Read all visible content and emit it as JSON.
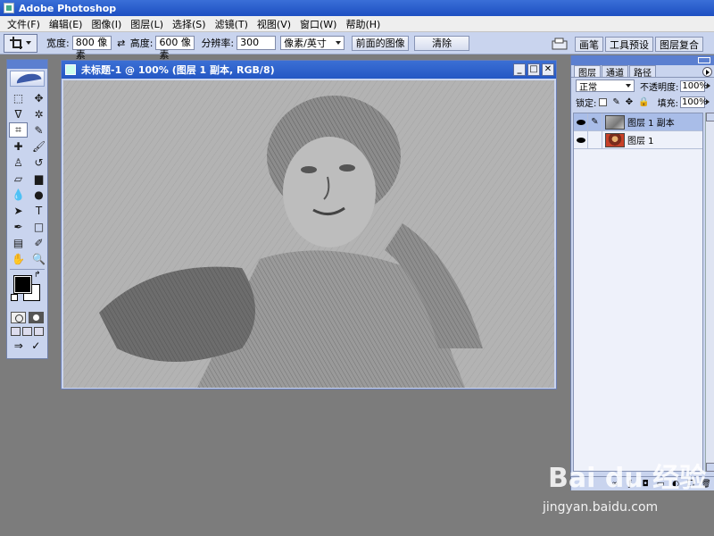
{
  "app": {
    "title": "Adobe Photoshop"
  },
  "menu": {
    "items": [
      "文件(F)",
      "编辑(E)",
      "图像(I)",
      "图层(L)",
      "选择(S)",
      "滤镜(T)",
      "视图(V)",
      "窗口(W)",
      "帮助(H)"
    ]
  },
  "options": {
    "width_label": "宽度:",
    "width_value": "800 像素",
    "height_label": "高度:",
    "height_value": "600 像素",
    "resolution_label": "分辨率:",
    "resolution_value": "300",
    "unit_value": "像素/英寸",
    "front_image_label": "前面的图像",
    "clear_label": "清除"
  },
  "palette_well": {
    "tabs": [
      "画笔",
      "工具预设",
      "图层复合"
    ]
  },
  "toolbox": {
    "tools": [
      {
        "name": "marquee-tool-icon",
        "glyph": "⬚"
      },
      {
        "name": "move-tool-icon",
        "glyph": "✥"
      },
      {
        "name": "lasso-tool-icon",
        "glyph": "ᐁ"
      },
      {
        "name": "magic-wand-tool-icon",
        "glyph": "✲"
      },
      {
        "name": "crop-tool-icon",
        "glyph": "⌗"
      },
      {
        "name": "slice-tool-icon",
        "glyph": "✎"
      },
      {
        "name": "healing-brush-tool-icon",
        "glyph": "✚"
      },
      {
        "name": "brush-tool-icon",
        "glyph": "🖌"
      },
      {
        "name": "clone-stamp-tool-icon",
        "glyph": "♙"
      },
      {
        "name": "history-brush-tool-icon",
        "glyph": "↺"
      },
      {
        "name": "eraser-tool-icon",
        "glyph": "▱"
      },
      {
        "name": "gradient-tool-icon",
        "glyph": "▆"
      },
      {
        "name": "blur-tool-icon",
        "glyph": "💧"
      },
      {
        "name": "dodge-tool-icon",
        "glyph": "●"
      },
      {
        "name": "path-selection-tool-icon",
        "glyph": "➤"
      },
      {
        "name": "type-tool-icon",
        "glyph": "T"
      },
      {
        "name": "pen-tool-icon",
        "glyph": "✒"
      },
      {
        "name": "shape-tool-icon",
        "glyph": "□"
      },
      {
        "name": "notes-tool-icon",
        "glyph": "▤"
      },
      {
        "name": "eyedropper-tool-icon",
        "glyph": "✐"
      },
      {
        "name": "hand-tool-icon",
        "glyph": "✋"
      },
      {
        "name": "zoom-tool-icon",
        "glyph": "🔍"
      }
    ]
  },
  "document": {
    "title": "未标题-1 @ 100% (图层 1 副本, RGB/8)"
  },
  "layers_panel": {
    "tabs": [
      "图层",
      "通道",
      "路径"
    ],
    "blend_mode": "正常",
    "opacity_label": "不透明度:",
    "opacity_value": "100%",
    "lock_label": "锁定:",
    "fill_label": "填充:",
    "fill_value": "100%",
    "layers": [
      {
        "name": "图层 1 副本",
        "selected": true
      },
      {
        "name": "图层 1",
        "selected": false
      }
    ]
  },
  "watermark": {
    "logo": "Bai du 经验",
    "url": "jingyan.baidu.com"
  },
  "colors": {
    "foreground": "#000000",
    "background": "#ffffff",
    "accent": "#2457c4"
  }
}
